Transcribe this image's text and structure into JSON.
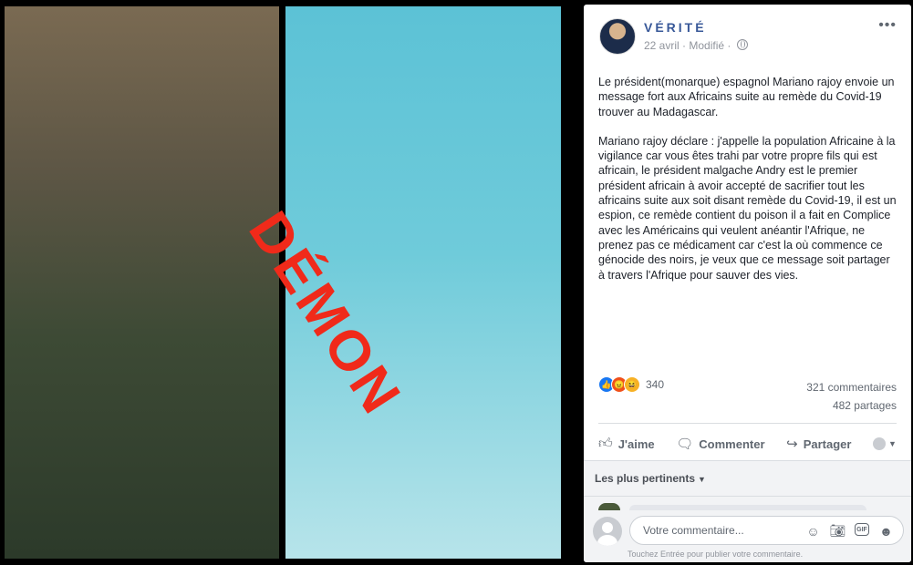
{
  "photos": {
    "stamp_text": "DÉMON",
    "stamp_color": "#f02a1a"
  },
  "post": {
    "page_name": "VÉRITÉ",
    "date": "22 avril",
    "edited": "Modifié",
    "paragraphs": [
      "Le président(monarque) espagnol Mariano rajoy envoie un message fort aux Africains suite au remède du Covid-19 trouver au Madagascar.",
      "Mariano rajoy déclare : j'appelle la population Africaine à la vigilance car vous êtes trahi par votre propre fils qui est africain, le président malgache Andry est le premier président africain à avoir accepté de sacrifier tout les africains suite aux soit disant remède du Covid-19, il est un espion, ce remède contient du poison il a fait en Complice avec les Américains qui veulent anéantir l'Afrique, ne prenez pas ce médicament car c'est la où commence ce génocide des noirs, je veux que ce message soit partager à travers l'Afrique pour sauver des vies."
    ],
    "reaction_count": "340",
    "reaction_icons": [
      "like-icon",
      "angry-icon",
      "haha-icon"
    ],
    "comments_count": "321 commentaires",
    "shares_count": "482 partages"
  },
  "actions": {
    "like": "J'aime",
    "comment": "Commenter",
    "share": "Partager"
  },
  "comments": {
    "sort_label": "Les plus pertinents",
    "placeholder": "Votre commentaire...",
    "hint": "Touchez Entrée pour publier votre commentaire."
  },
  "colors": {
    "link_blue": "#385898",
    "like_blue": "#1877f2",
    "angry_orange": "#f0501a",
    "haha_yellow": "#f7b125"
  }
}
